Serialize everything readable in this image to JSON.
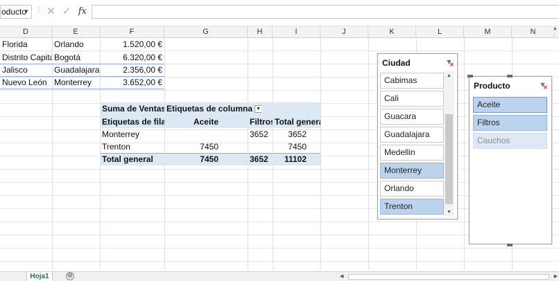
{
  "formula_bar": {
    "name_box": "oducto",
    "cancel_icon": "✕",
    "enter_icon": "✓",
    "fx_label": "fx",
    "formula_value": ""
  },
  "columns": [
    "D",
    "E",
    "F",
    "G",
    "H",
    "I",
    "J",
    "K",
    "L",
    "M",
    "N"
  ],
  "source_table": {
    "rows": [
      {
        "state": "Florida",
        "city": "Orlando",
        "amount": "1.520,00 €"
      },
      {
        "state": "Distrito Capital",
        "city": "Bogotá",
        "amount": "6.320,00 €"
      },
      {
        "state": "Jalisco",
        "city": "Guadalajara",
        "amount": "2.356,00 €"
      },
      {
        "state": "Nuevo León",
        "city": "Monterrey",
        "amount": "3.652,00 €"
      }
    ]
  },
  "pivot": {
    "value_label": "Suma de Ventas",
    "column_labels": "Etiquetas de columna",
    "row_labels": "Etiquetas de fila",
    "headers": [
      "Aceite",
      "Filtros",
      "Total general"
    ],
    "rows": [
      {
        "label": "Monterrey",
        "aceite": "",
        "filtros": "3652",
        "total": "3652"
      },
      {
        "label": "Trenton",
        "aceite": "7450",
        "filtros": "",
        "total": "7450"
      }
    ],
    "total": {
      "label": "Total general",
      "aceite": "7450",
      "filtros": "3652",
      "total": "11102"
    }
  },
  "slicer_ciudad": {
    "title": "Ciudad",
    "items": [
      {
        "label": "Cabimas",
        "state": "normal"
      },
      {
        "label": "Cali",
        "state": "normal"
      },
      {
        "label": "Guacara",
        "state": "normal"
      },
      {
        "label": "Guadalajara",
        "state": "normal"
      },
      {
        "label": "Medellin",
        "state": "normal"
      },
      {
        "label": "Monterrey",
        "state": "selected"
      },
      {
        "label": "Orlando",
        "state": "normal"
      },
      {
        "label": "Trenton",
        "state": "selected"
      }
    ]
  },
  "slicer_producto": {
    "title": "Producto",
    "items": [
      {
        "label": "Aceite",
        "state": "selected"
      },
      {
        "label": "Filtros",
        "state": "selected"
      },
      {
        "label": "Cauchos",
        "state": "disabled"
      }
    ]
  },
  "sheet_tabs": {
    "active": "Hoja1",
    "add_icon": "⊕"
  },
  "colors": {
    "selected_item": "#bcd3ee",
    "disabled_item": "#dfe8f4",
    "pivot_header": "#dde8f5",
    "sheet_tab_text": "#217346"
  }
}
